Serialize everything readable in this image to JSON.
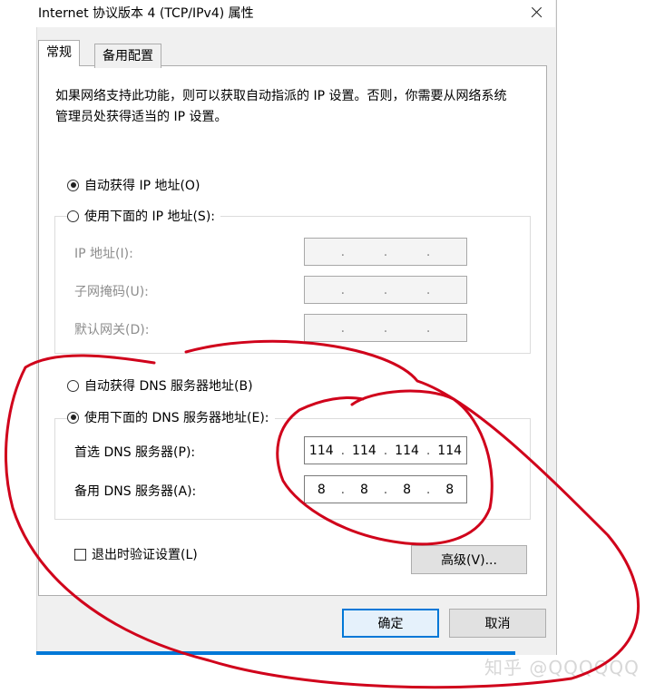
{
  "window": {
    "title": "Internet 协议版本 4 (TCP/IPv4) 属性"
  },
  "tabs": [
    {
      "label": "常规",
      "active": true
    },
    {
      "label": "备用配置",
      "active": false
    }
  ],
  "intro_text": "如果网络支持此功能，则可以获取自动指派的 IP 设置。否则，你需要从网络系统管理员处获得适当的 IP 设置。",
  "ip_mode": {
    "auto_label": "自动获得 IP 地址(O)",
    "auto_selected": true,
    "manual_label": "使用下面的 IP 地址(S):",
    "manual_selected": false
  },
  "ip_fields": [
    {
      "label": "IP 地址(I):",
      "octets": [
        "",
        "",
        "",
        ""
      ],
      "enabled": false
    },
    {
      "label": "子网掩码(U):",
      "octets": [
        "",
        "",
        "",
        ""
      ],
      "enabled": false
    },
    {
      "label": "默认网关(D):",
      "octets": [
        "",
        "",
        "",
        ""
      ],
      "enabled": false
    }
  ],
  "dns_mode": {
    "auto_label": "自动获得 DNS 服务器地址(B)",
    "auto_selected": false,
    "manual_label": "使用下面的 DNS 服务器地址(E):",
    "manual_selected": true
  },
  "dns_fields": [
    {
      "label": "首选 DNS 服务器(P):",
      "octets": [
        "114",
        "114",
        "114",
        "114"
      ],
      "enabled": true
    },
    {
      "label": "备用 DNS 服务器(A):",
      "octets": [
        "8",
        "8",
        "8",
        "8"
      ],
      "enabled": true
    }
  ],
  "validate": {
    "label": "退出时验证设置(L)",
    "checked": false
  },
  "buttons": {
    "advanced": "高级(V)...",
    "ok": "确定",
    "cancel": "取消"
  },
  "watermark": "知乎 @QQQQQQ",
  "colors": {
    "accent": "#0078d7",
    "annotation": "#d0021b"
  }
}
